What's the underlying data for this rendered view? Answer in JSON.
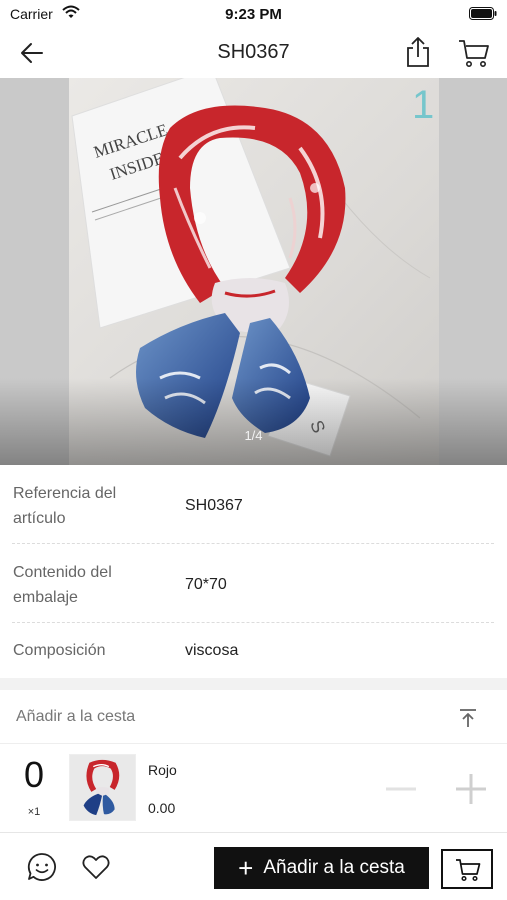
{
  "status_bar": {
    "carrier": "Carrier",
    "time": "9:23 PM"
  },
  "nav": {
    "title": "SH0367"
  },
  "gallery": {
    "page_indicator": "1/4",
    "card_text_line1": "MIRACLE",
    "card_text_line2": "INSIDE",
    "corner_mark": "1",
    "tag_letter": "S"
  },
  "specs": [
    {
      "label": "Referencia del artículo",
      "value": "SH0367"
    },
    {
      "label": "Contenido del embalaje",
      "value": "70*70"
    },
    {
      "label": "Composición",
      "value": "viscosa"
    }
  ],
  "cart_section": {
    "title": "Añadir a la cesta"
  },
  "variant": {
    "quantity": "0",
    "multiplier": "×1",
    "color_name": "Rojo",
    "price": "0.00"
  },
  "bottom_bar": {
    "add_label": "Añadir a la cesta"
  },
  "colors": {
    "primary": "#111111",
    "scarf_red": "#c8262c",
    "scarf_blue": "#1f3f86",
    "divider": "#dcdcdc"
  },
  "icons": [
    "wifi-icon",
    "battery-icon",
    "back-arrow-icon",
    "share-icon",
    "cart-icon",
    "collapse-to-top-icon",
    "minus-icon",
    "plus-icon",
    "chat-icon",
    "heart-icon"
  ]
}
